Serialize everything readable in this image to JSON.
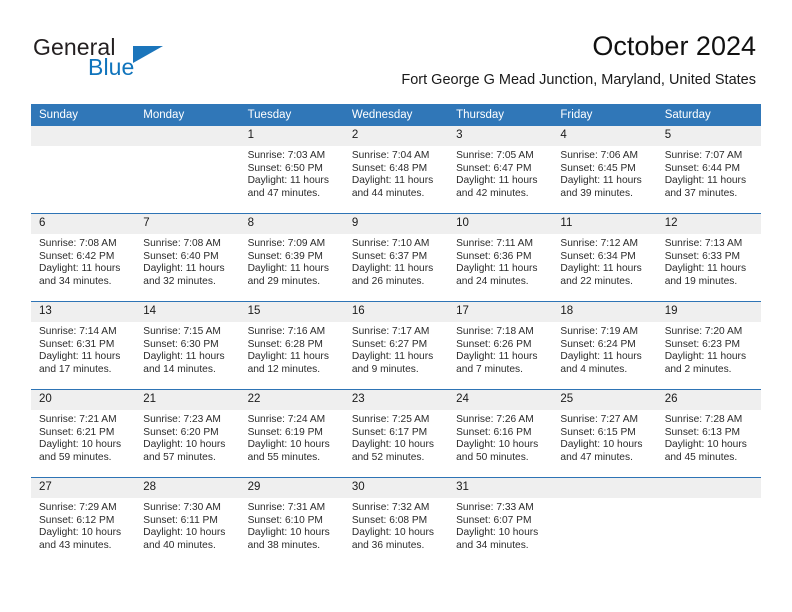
{
  "brand": {
    "name_part1": "General",
    "name_part2": "Blue",
    "logo_icon": "triangle-icon"
  },
  "header": {
    "month_title": "October 2024",
    "location": "Fort George G Mead Junction, Maryland, United States"
  },
  "colors": {
    "header_blue": "#3077b8",
    "row_divider_blue": "#2e74b5",
    "daynum_strip_gray": "#efefef",
    "brand_blue": "#1074bc",
    "text": "#1a1a1a"
  },
  "calendar": {
    "weekdays": [
      "Sunday",
      "Monday",
      "Tuesday",
      "Wednesday",
      "Thursday",
      "Friday",
      "Saturday"
    ],
    "labels": {
      "sunrise": "Sunrise:",
      "sunset": "Sunset:",
      "daylight": "Daylight:"
    },
    "weeks": [
      [
        {
          "day": "",
          "sunrise": "",
          "sunset": "",
          "daylight_line1": "",
          "daylight_line2": ""
        },
        {
          "day": "",
          "sunrise": "",
          "sunset": "",
          "daylight_line1": "",
          "daylight_line2": ""
        },
        {
          "day": "1",
          "sunrise": "Sunrise: 7:03 AM",
          "sunset": "Sunset: 6:50 PM",
          "daylight_line1": "Daylight: 11 hours",
          "daylight_line2": "and 47 minutes."
        },
        {
          "day": "2",
          "sunrise": "Sunrise: 7:04 AM",
          "sunset": "Sunset: 6:48 PM",
          "daylight_line1": "Daylight: 11 hours",
          "daylight_line2": "and 44 minutes."
        },
        {
          "day": "3",
          "sunrise": "Sunrise: 7:05 AM",
          "sunset": "Sunset: 6:47 PM",
          "daylight_line1": "Daylight: 11 hours",
          "daylight_line2": "and 42 minutes."
        },
        {
          "day": "4",
          "sunrise": "Sunrise: 7:06 AM",
          "sunset": "Sunset: 6:45 PM",
          "daylight_line1": "Daylight: 11 hours",
          "daylight_line2": "and 39 minutes."
        },
        {
          "day": "5",
          "sunrise": "Sunrise: 7:07 AM",
          "sunset": "Sunset: 6:44 PM",
          "daylight_line1": "Daylight: 11 hours",
          "daylight_line2": "and 37 minutes."
        }
      ],
      [
        {
          "day": "6",
          "sunrise": "Sunrise: 7:08 AM",
          "sunset": "Sunset: 6:42 PM",
          "daylight_line1": "Daylight: 11 hours",
          "daylight_line2": "and 34 minutes."
        },
        {
          "day": "7",
          "sunrise": "Sunrise: 7:08 AM",
          "sunset": "Sunset: 6:40 PM",
          "daylight_line1": "Daylight: 11 hours",
          "daylight_line2": "and 32 minutes."
        },
        {
          "day": "8",
          "sunrise": "Sunrise: 7:09 AM",
          "sunset": "Sunset: 6:39 PM",
          "daylight_line1": "Daylight: 11 hours",
          "daylight_line2": "and 29 minutes."
        },
        {
          "day": "9",
          "sunrise": "Sunrise: 7:10 AM",
          "sunset": "Sunset: 6:37 PM",
          "daylight_line1": "Daylight: 11 hours",
          "daylight_line2": "and 26 minutes."
        },
        {
          "day": "10",
          "sunrise": "Sunrise: 7:11 AM",
          "sunset": "Sunset: 6:36 PM",
          "daylight_line1": "Daylight: 11 hours",
          "daylight_line2": "and 24 minutes."
        },
        {
          "day": "11",
          "sunrise": "Sunrise: 7:12 AM",
          "sunset": "Sunset: 6:34 PM",
          "daylight_line1": "Daylight: 11 hours",
          "daylight_line2": "and 22 minutes."
        },
        {
          "day": "12",
          "sunrise": "Sunrise: 7:13 AM",
          "sunset": "Sunset: 6:33 PM",
          "daylight_line1": "Daylight: 11 hours",
          "daylight_line2": "and 19 minutes."
        }
      ],
      [
        {
          "day": "13",
          "sunrise": "Sunrise: 7:14 AM",
          "sunset": "Sunset: 6:31 PM",
          "daylight_line1": "Daylight: 11 hours",
          "daylight_line2": "and 17 minutes."
        },
        {
          "day": "14",
          "sunrise": "Sunrise: 7:15 AM",
          "sunset": "Sunset: 6:30 PM",
          "daylight_line1": "Daylight: 11 hours",
          "daylight_line2": "and 14 minutes."
        },
        {
          "day": "15",
          "sunrise": "Sunrise: 7:16 AM",
          "sunset": "Sunset: 6:28 PM",
          "daylight_line1": "Daylight: 11 hours",
          "daylight_line2": "and 12 minutes."
        },
        {
          "day": "16",
          "sunrise": "Sunrise: 7:17 AM",
          "sunset": "Sunset: 6:27 PM",
          "daylight_line1": "Daylight: 11 hours",
          "daylight_line2": "and 9 minutes."
        },
        {
          "day": "17",
          "sunrise": "Sunrise: 7:18 AM",
          "sunset": "Sunset: 6:26 PM",
          "daylight_line1": "Daylight: 11 hours",
          "daylight_line2": "and 7 minutes."
        },
        {
          "day": "18",
          "sunrise": "Sunrise: 7:19 AM",
          "sunset": "Sunset: 6:24 PM",
          "daylight_line1": "Daylight: 11 hours",
          "daylight_line2": "and 4 minutes."
        },
        {
          "day": "19",
          "sunrise": "Sunrise: 7:20 AM",
          "sunset": "Sunset: 6:23 PM",
          "daylight_line1": "Daylight: 11 hours",
          "daylight_line2": "and 2 minutes."
        }
      ],
      [
        {
          "day": "20",
          "sunrise": "Sunrise: 7:21 AM",
          "sunset": "Sunset: 6:21 PM",
          "daylight_line1": "Daylight: 10 hours",
          "daylight_line2": "and 59 minutes."
        },
        {
          "day": "21",
          "sunrise": "Sunrise: 7:23 AM",
          "sunset": "Sunset: 6:20 PM",
          "daylight_line1": "Daylight: 10 hours",
          "daylight_line2": "and 57 minutes."
        },
        {
          "day": "22",
          "sunrise": "Sunrise: 7:24 AM",
          "sunset": "Sunset: 6:19 PM",
          "daylight_line1": "Daylight: 10 hours",
          "daylight_line2": "and 55 minutes."
        },
        {
          "day": "23",
          "sunrise": "Sunrise: 7:25 AM",
          "sunset": "Sunset: 6:17 PM",
          "daylight_line1": "Daylight: 10 hours",
          "daylight_line2": "and 52 minutes."
        },
        {
          "day": "24",
          "sunrise": "Sunrise: 7:26 AM",
          "sunset": "Sunset: 6:16 PM",
          "daylight_line1": "Daylight: 10 hours",
          "daylight_line2": "and 50 minutes."
        },
        {
          "day": "25",
          "sunrise": "Sunrise: 7:27 AM",
          "sunset": "Sunset: 6:15 PM",
          "daylight_line1": "Daylight: 10 hours",
          "daylight_line2": "and 47 minutes."
        },
        {
          "day": "26",
          "sunrise": "Sunrise: 7:28 AM",
          "sunset": "Sunset: 6:13 PM",
          "daylight_line1": "Daylight: 10 hours",
          "daylight_line2": "and 45 minutes."
        }
      ],
      [
        {
          "day": "27",
          "sunrise": "Sunrise: 7:29 AM",
          "sunset": "Sunset: 6:12 PM",
          "daylight_line1": "Daylight: 10 hours",
          "daylight_line2": "and 43 minutes."
        },
        {
          "day": "28",
          "sunrise": "Sunrise: 7:30 AM",
          "sunset": "Sunset: 6:11 PM",
          "daylight_line1": "Daylight: 10 hours",
          "daylight_line2": "and 40 minutes."
        },
        {
          "day": "29",
          "sunrise": "Sunrise: 7:31 AM",
          "sunset": "Sunset: 6:10 PM",
          "daylight_line1": "Daylight: 10 hours",
          "daylight_line2": "and 38 minutes."
        },
        {
          "day": "30",
          "sunrise": "Sunrise: 7:32 AM",
          "sunset": "Sunset: 6:08 PM",
          "daylight_line1": "Daylight: 10 hours",
          "daylight_line2": "and 36 minutes."
        },
        {
          "day": "31",
          "sunrise": "Sunrise: 7:33 AM",
          "sunset": "Sunset: 6:07 PM",
          "daylight_line1": "Daylight: 10 hours",
          "daylight_line2": "and 34 minutes."
        },
        {
          "day": "",
          "sunrise": "",
          "sunset": "",
          "daylight_line1": "",
          "daylight_line2": ""
        },
        {
          "day": "",
          "sunrise": "",
          "sunset": "",
          "daylight_line1": "",
          "daylight_line2": ""
        }
      ]
    ]
  }
}
